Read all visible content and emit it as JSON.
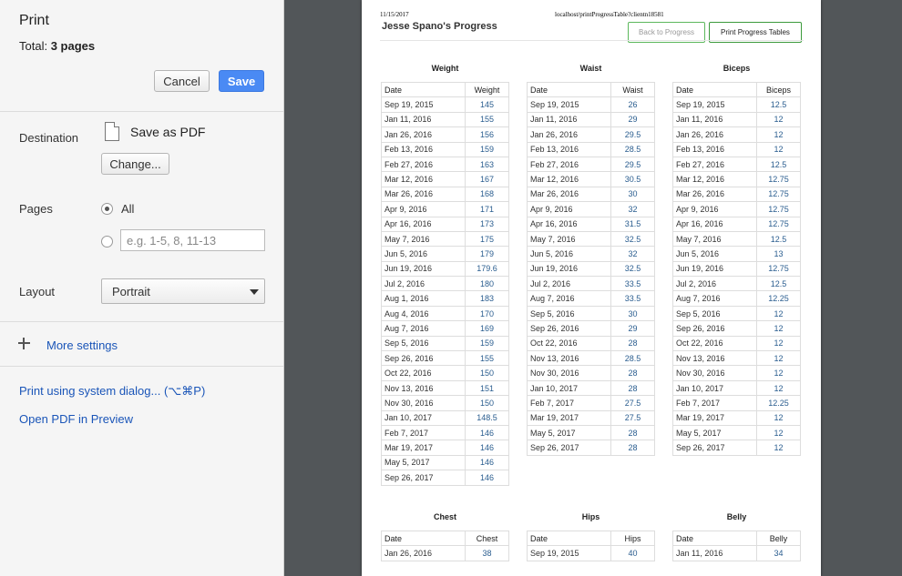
{
  "panel": {
    "title": "Print",
    "total_label": "Total:",
    "total_value": "3 pages",
    "cancel_label": "Cancel",
    "save_label": "Save",
    "destination_label": "Destination",
    "destination_name": "Save as PDF",
    "change_label": "Change...",
    "pages_label": "Pages",
    "pages_all_label": "All",
    "pages_placeholder": "e.g. 1-5, 8, 11-13",
    "layout_label": "Layout",
    "layout_value": "Portrait",
    "more_settings_label": "More settings",
    "system_dialog_link": "Print using system dialog... (⌥⌘P)",
    "open_pdf_link": "Open PDF in Preview"
  },
  "preview": {
    "date": "11/15/2017",
    "url": "localhost/printProgressTable?clientn18581",
    "title": "Jesse Spano's Progress",
    "back_label": "Back to Progress",
    "print_tables_label": "Print Progress Tables"
  },
  "tables": [
    {
      "title": "Weight",
      "date_header": "Date",
      "value_header": "Weight",
      "rows": [
        [
          "Sep 19, 2015",
          "145"
        ],
        [
          "Jan 11, 2016",
          "155"
        ],
        [
          "Jan 26, 2016",
          "156"
        ],
        [
          "Feb 13, 2016",
          "159"
        ],
        [
          "Feb 27, 2016",
          "163"
        ],
        [
          "Mar 12, 2016",
          "167"
        ],
        [
          "Mar 26, 2016",
          "168"
        ],
        [
          "Apr 9, 2016",
          "171"
        ],
        [
          "Apr 16, 2016",
          "173"
        ],
        [
          "May 7, 2016",
          "175"
        ],
        [
          "Jun 5, 2016",
          "179"
        ],
        [
          "Jun 19, 2016",
          "179.6"
        ],
        [
          "Jul 2, 2016",
          "180"
        ],
        [
          "Aug 1, 2016",
          "183"
        ],
        [
          "Aug 4, 2016",
          "170"
        ],
        [
          "Aug 7, 2016",
          "169"
        ],
        [
          "Sep 5, 2016",
          "159"
        ],
        [
          "Sep 26, 2016",
          "155"
        ],
        [
          "Oct 22, 2016",
          "150"
        ],
        [
          "Nov 13, 2016",
          "151"
        ],
        [
          "Nov 30, 2016",
          "150"
        ],
        [
          "Jan 10, 2017",
          "148.5"
        ],
        [
          "Feb 7, 2017",
          "146"
        ],
        [
          "Mar 19, 2017",
          "146"
        ],
        [
          "May 5, 2017",
          "146"
        ],
        [
          "Sep 26, 2017",
          "146"
        ]
      ]
    },
    {
      "title": "Waist",
      "date_header": "Date",
      "value_header": "Waist",
      "rows": [
        [
          "Sep 19, 2015",
          "26"
        ],
        [
          "Jan 11, 2016",
          "29"
        ],
        [
          "Jan 26, 2016",
          "29.5"
        ],
        [
          "Feb 13, 2016",
          "28.5"
        ],
        [
          "Feb 27, 2016",
          "29.5"
        ],
        [
          "Mar 12, 2016",
          "30.5"
        ],
        [
          "Mar 26, 2016",
          "30"
        ],
        [
          "Apr 9, 2016",
          "32"
        ],
        [
          "Apr 16, 2016",
          "31.5"
        ],
        [
          "May 7, 2016",
          "32.5"
        ],
        [
          "Jun 5, 2016",
          "32"
        ],
        [
          "Jun 19, 2016",
          "32.5"
        ],
        [
          "Jul 2, 2016",
          "33.5"
        ],
        [
          "Aug 7, 2016",
          "33.5"
        ],
        [
          "Sep 5, 2016",
          "30"
        ],
        [
          "Sep 26, 2016",
          "29"
        ],
        [
          "Oct 22, 2016",
          "28"
        ],
        [
          "Nov 13, 2016",
          "28.5"
        ],
        [
          "Nov 30, 2016",
          "28"
        ],
        [
          "Jan 10, 2017",
          "28"
        ],
        [
          "Feb 7, 2017",
          "27.5"
        ],
        [
          "Mar 19, 2017",
          "27.5"
        ],
        [
          "May 5, 2017",
          "28"
        ],
        [
          "Sep 26, 2017",
          "28"
        ]
      ]
    },
    {
      "title": "Biceps",
      "date_header": "Date",
      "value_header": "Biceps",
      "rows": [
        [
          "Sep 19, 2015",
          "12.5"
        ],
        [
          "Jan 11, 2016",
          "12"
        ],
        [
          "Jan 26, 2016",
          "12"
        ],
        [
          "Feb 13, 2016",
          "12"
        ],
        [
          "Feb 27, 2016",
          "12.5"
        ],
        [
          "Mar 12, 2016",
          "12.75"
        ],
        [
          "Mar 26, 2016",
          "12.75"
        ],
        [
          "Apr 9, 2016",
          "12.75"
        ],
        [
          "Apr 16, 2016",
          "12.75"
        ],
        [
          "May 7, 2016",
          "12.5"
        ],
        [
          "Jun 5, 2016",
          "13"
        ],
        [
          "Jun 19, 2016",
          "12.75"
        ],
        [
          "Jul 2, 2016",
          "12.5"
        ],
        [
          "Aug 7, 2016",
          "12.25"
        ],
        [
          "Sep 5, 2016",
          "12"
        ],
        [
          "Sep 26, 2016",
          "12"
        ],
        [
          "Oct 22, 2016",
          "12"
        ],
        [
          "Nov 13, 2016",
          "12"
        ],
        [
          "Nov 30, 2016",
          "12"
        ],
        [
          "Jan 10, 2017",
          "12"
        ],
        [
          "Feb 7, 2017",
          "12.25"
        ],
        [
          "Mar 19, 2017",
          "12"
        ],
        [
          "May 5, 2017",
          "12"
        ],
        [
          "Sep 26, 2017",
          "12"
        ]
      ]
    },
    {
      "title": "Chest",
      "date_header": "Date",
      "value_header": "Chest",
      "rows": [
        [
          "Jan 26, 2016",
          "38"
        ]
      ]
    },
    {
      "title": "Hips",
      "date_header": "Date",
      "value_header": "Hips",
      "rows": [
        [
          "Sep 19, 2015",
          "40"
        ]
      ]
    },
    {
      "title": "Belly",
      "date_header": "Date",
      "value_header": "Belly",
      "rows": [
        [
          "Jan 11, 2016",
          "34"
        ]
      ]
    }
  ]
}
